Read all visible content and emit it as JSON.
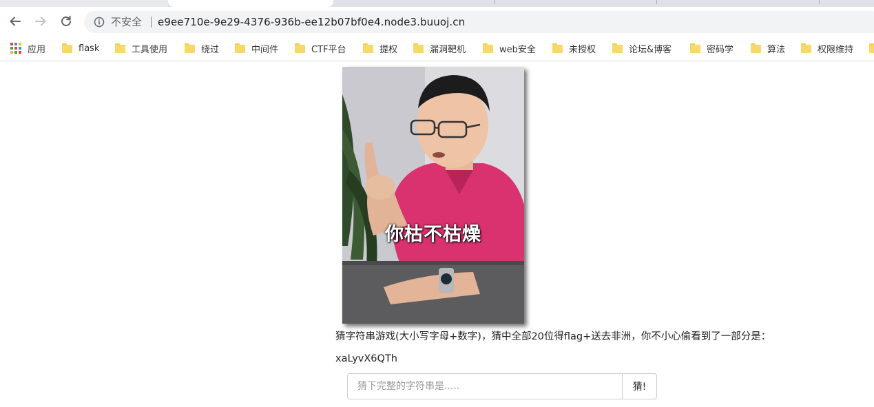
{
  "browser": {
    "security_label": "不安全",
    "url": "e9ee710e-9e29-4376-936b-ee12b07bf0e4.node3.buuoj.cn"
  },
  "bookmarks": [
    {
      "label": "应用",
      "icon": "apps-grid-icon"
    },
    {
      "label": "flask",
      "icon": "folder-icon"
    },
    {
      "label": "工具使用",
      "icon": "folder-icon"
    },
    {
      "label": "绕过",
      "icon": "folder-icon"
    },
    {
      "label": "中间件",
      "icon": "folder-icon"
    },
    {
      "label": "CTF平台",
      "icon": "folder-icon"
    },
    {
      "label": "提权",
      "icon": "folder-icon"
    },
    {
      "label": "漏洞靶机",
      "icon": "folder-icon"
    },
    {
      "label": "web安全",
      "icon": "folder-icon"
    },
    {
      "label": "未授权",
      "icon": "folder-icon"
    },
    {
      "label": "论坛&博客",
      "icon": "folder-icon"
    },
    {
      "label": "密码学",
      "icon": "folder-icon"
    },
    {
      "label": "算法",
      "icon": "folder-icon"
    },
    {
      "label": "权限维持",
      "icon": "folder-icon"
    }
  ],
  "page": {
    "meme_caption": "你枯不枯燥",
    "prompt": "猜字符串游戏(大小写字母+数字)，猜中全部20位得flag+送去非洲，你不小心偷看到了一部分是：",
    "partial_string": "xaLyvX6QTh",
    "guess_placeholder": "猜下完整的字符串是.....",
    "guess_button": "猜!"
  },
  "colors": {
    "shirt": "#d9326e",
    "folder": "#f7d96b",
    "toolbar_bg": "#f1f3f4"
  }
}
